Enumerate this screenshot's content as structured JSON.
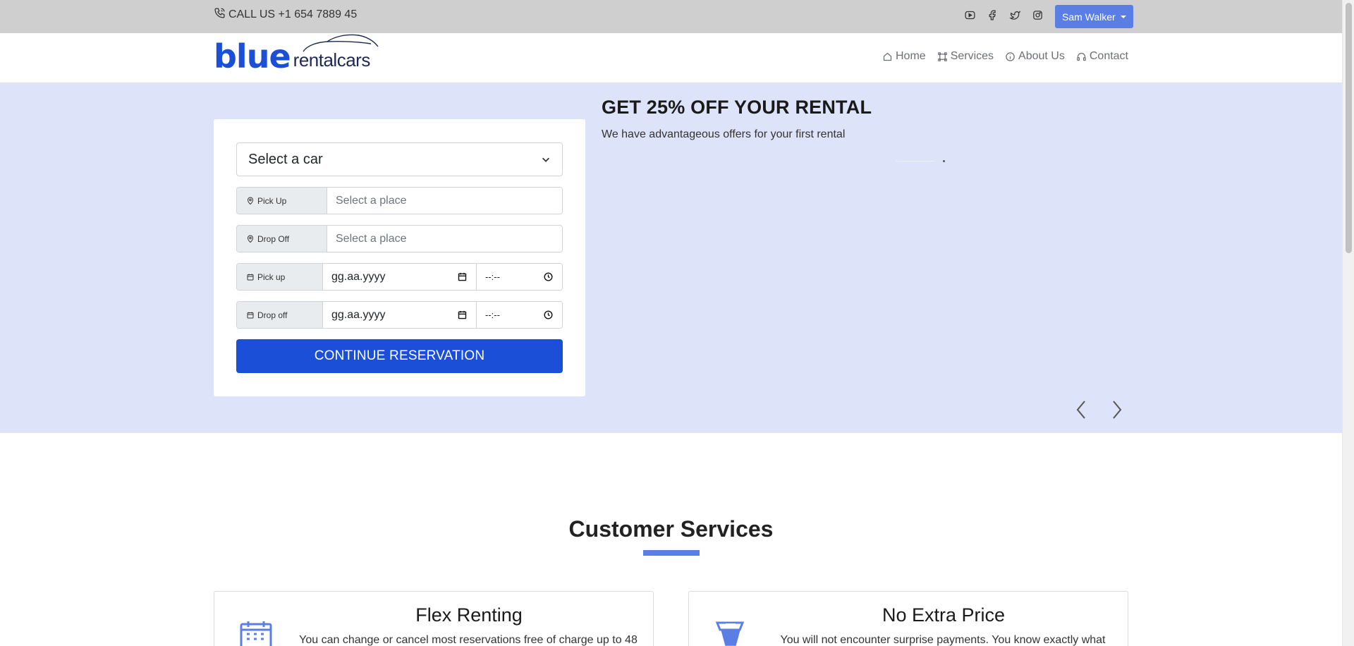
{
  "topbar": {
    "phone_label": "CALL US +1 654 7889 45",
    "social_icons": [
      "youtube-icon",
      "facebook-icon",
      "twitter-icon",
      "instagram-icon"
    ],
    "user_name": "Sam Walker"
  },
  "navbar": {
    "logo_main": "blue",
    "logo_sub": "rentalcars",
    "links": [
      {
        "label": "Home",
        "icon": "home-icon"
      },
      {
        "label": "Services",
        "icon": "services-icon"
      },
      {
        "label": "About Us",
        "icon": "info-icon"
      },
      {
        "label": "Contact",
        "icon": "headset-icon"
      }
    ]
  },
  "reservation": {
    "car_select_value": "Select a car",
    "pickup_place_label": "Pick Up",
    "pickup_place_placeholder": "Select a place",
    "dropoff_place_label": "Drop Off",
    "dropoff_place_placeholder": "Select a place",
    "pickup_date_label": "Pick up",
    "pickup_date_value": "gg.aa.yyyy",
    "pickup_time_value": "--:--",
    "dropoff_date_label": "Drop off",
    "dropoff_date_value": "gg.aa.yyyy",
    "dropoff_time_value": "--:--",
    "continue_label": "CONTINUE RESERVATION"
  },
  "promo": {
    "title": "GET 25% OFF YOUR RENTAL",
    "subtitle": "We have advantageous offers for your first rental"
  },
  "services": {
    "title": "Customer Services",
    "cards": [
      {
        "title": "Flex Renting",
        "text": "You can change or cancel most reservations free of charge up to 48",
        "icon": "calendar-icon"
      },
      {
        "title": "No Extra Price",
        "text": "You will not encounter surprise payments. You know exactly what",
        "icon": "money-icon"
      }
    ]
  },
  "colors": {
    "brand_blue": "#1b4fd8",
    "hero_bg": "#dde3f8",
    "accent": "#5b7ee5"
  }
}
